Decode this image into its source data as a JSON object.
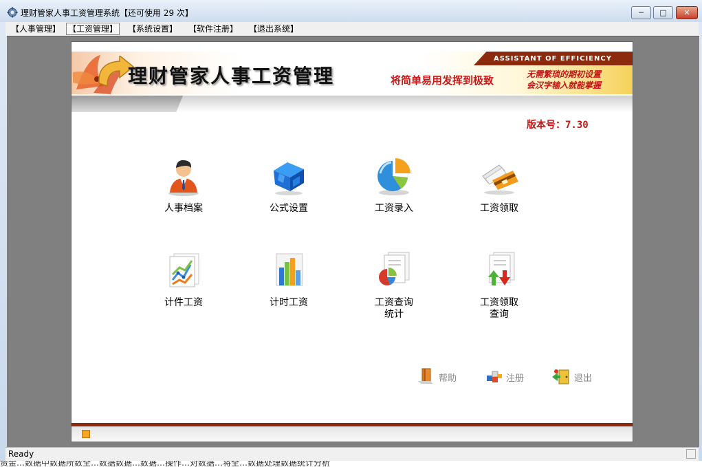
{
  "window": {
    "title": "理财管家人事工资管理系统【还可使用 29 次】",
    "controls": {
      "minimize": "─",
      "maximize": "□",
      "close": "✕"
    }
  },
  "menu": [
    "【人事管理】",
    "【工资管理】",
    "【系统设置】",
    "【软件注册】",
    "【退出系统】"
  ],
  "banner": {
    "brand": "理财管家人事工资管理",
    "tagline_en": "ASSISTANT OF EFFICIENCY",
    "slogan": "将简单易用发挥到极致",
    "tip_line1": "无需繁琐的期初设置",
    "tip_line2": "会汉字输入就能掌握"
  },
  "version": "版本号：7.30",
  "modules": [
    {
      "label": "人事档案",
      "icon": "person-icon"
    },
    {
      "label": "公式设置",
      "icon": "cube-icon"
    },
    {
      "label": "工资录入",
      "icon": "pie-chart-icon"
    },
    {
      "label": "工资领取",
      "icon": "card-icon"
    },
    {
      "label": "计件工资",
      "icon": "line-chart-icon"
    },
    {
      "label": "计时工资",
      "icon": "bar-chart-icon"
    },
    {
      "label": "工资查询统计",
      "line1": "工资查询",
      "line2": "统计",
      "icon": "report-pie-icon"
    },
    {
      "label": "工资领取查询",
      "line1": "工资领取",
      "line2": "查询",
      "icon": "report-arrows-icon"
    }
  ],
  "actions": {
    "help": "帮助",
    "register": "注册",
    "exit": "退出"
  },
  "status": {
    "text": "Ready"
  },
  "background_text": "资金…数据中数据所数全…数据数据…数据…操作…对数据…将全…数据处理数据统计分析"
}
